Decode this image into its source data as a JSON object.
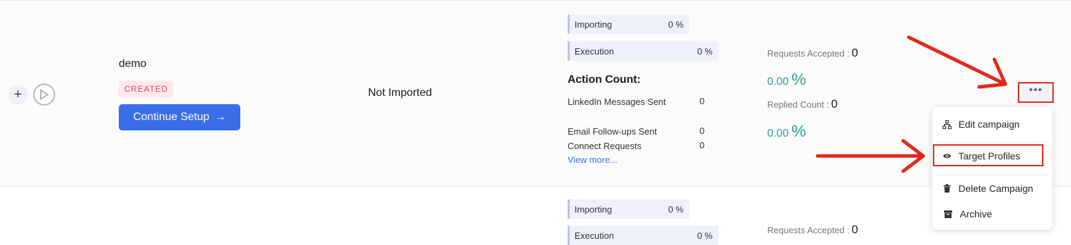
{
  "colors": {
    "primary_button": "#3a6ee8",
    "badge_bg": "#fde8ec",
    "badge_text": "#d6466b",
    "percent_green": "#2ba38a",
    "annotation_red": "#e02a1b"
  },
  "row1": {
    "campaign_name": "demo",
    "status_badge": "CREATED",
    "continue_button": "Continue Setup",
    "continue_arrow": "→",
    "import_status": "Not Imported",
    "progress": {
      "importing_label": "Importing",
      "importing_value": "0 %",
      "execution_label": "Execution",
      "execution_value": "0 %"
    },
    "action_count": {
      "title": "Action Count:",
      "items": [
        {
          "label": "LinkedIn Messages Sent",
          "value": "0"
        },
        {
          "label": "Email Follow-ups Sent",
          "value": "0"
        },
        {
          "label": "Connect Requests",
          "value": "0"
        }
      ],
      "view_more": "View more..."
    },
    "stats": {
      "requests_accepted_label": "Requests Accepted :",
      "requests_accepted_value": "0",
      "requests_accepted_pct": "0.00",
      "replied_count_label": "Replied Count :",
      "replied_count_value": "0",
      "replied_pct": "0.00",
      "pct_symbol": "%"
    },
    "more_button": "•••"
  },
  "row2": {
    "progress": {
      "importing_label": "Importing",
      "importing_value": "0 %",
      "execution_label": "Execution",
      "execution_value": "0 %"
    },
    "stats": {
      "requests_accepted_label": "Requests Accepted :",
      "requests_accepted_value": "0"
    }
  },
  "menu": {
    "items": [
      {
        "label": "Edit campaign",
        "icon": "sitemap-icon"
      },
      {
        "label": "Target Profiles",
        "icon": "eye-icon"
      },
      {
        "label": "Delete Campaign",
        "icon": "trash-icon"
      },
      {
        "label": "Archive",
        "icon": "archive-icon"
      }
    ]
  },
  "icons": {
    "plus": "+"
  }
}
